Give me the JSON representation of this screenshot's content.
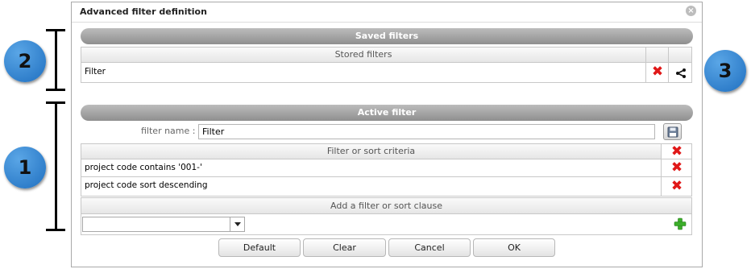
{
  "dialog": {
    "title": "Advanced filter definition",
    "close_glyph": "×"
  },
  "saved_filters": {
    "header": "Saved filters",
    "column_header": "Stored filters",
    "rows": [
      {
        "name": "Filter"
      }
    ]
  },
  "active_filter": {
    "header": "Active filter",
    "name_label": "filter name :",
    "name_value": "Filter",
    "criteria_header": "Filter or sort criteria",
    "criteria": [
      {
        "text": "project code contains '001-'"
      },
      {
        "text": "project code sort descending"
      }
    ],
    "add_clause_header": "Add a filter or sort clause",
    "clause_select_value": ""
  },
  "buttons": {
    "default_label": "Default",
    "clear_label": "Clear",
    "cancel_label": "Cancel",
    "ok_label": "OK"
  },
  "callouts": {
    "one": "1",
    "two": "2",
    "three": "3"
  },
  "icons": {
    "delete": "red-x-icon",
    "share": "share-icon",
    "save": "floppy-disk-icon",
    "add": "green-plus-icon",
    "dropdown": "chevron-down-icon"
  },
  "colors": {
    "delete_red": "#e01818",
    "add_green": "#3cae2a",
    "callout_blue": "#2f86d6",
    "section_header_gray": "#a0a0a0"
  }
}
